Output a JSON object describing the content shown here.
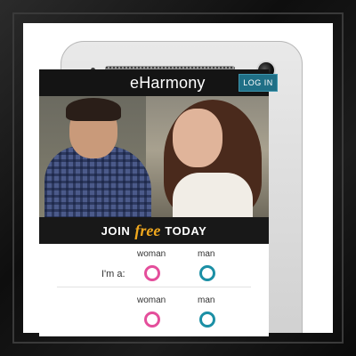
{
  "app": {
    "logo_text": "eHarmony",
    "login_button": "LOG IN"
  },
  "banner": {
    "join": "JOIN",
    "free": "free",
    "today": "TODAY"
  },
  "form": {
    "row1": {
      "label": "I'm a:",
      "option_woman": "woman",
      "option_man": "man"
    },
    "row2": {
      "option_woman": "woman",
      "option_man": "man"
    }
  },
  "colors": {
    "login_button_bg": "#1f6f86",
    "free_accent": "#f0a81e",
    "woman_ring": "#e44e9b",
    "man_ring": "#1b8fa5"
  }
}
